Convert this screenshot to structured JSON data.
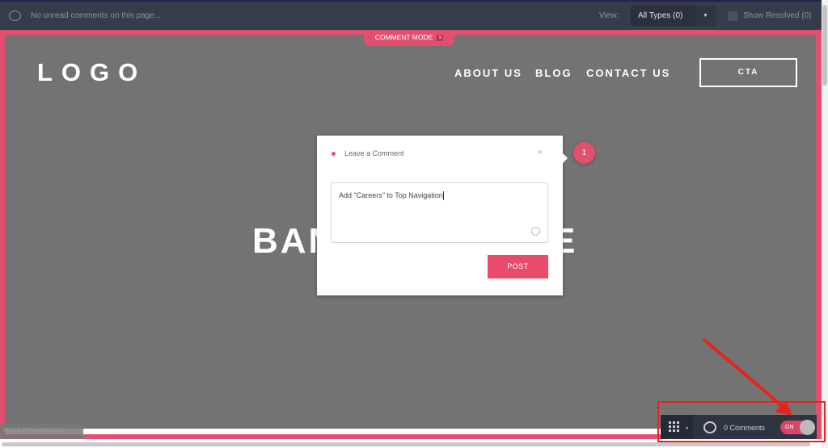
{
  "topbar": {
    "status": "No unread comments on this page...",
    "view_label": "View:",
    "view_select": "All Types (0)",
    "show_resolved": "Show Resolved (0)"
  },
  "comment_mode": {
    "label": "COMMENT MODE",
    "close": "x"
  },
  "site": {
    "logo": "LOGO",
    "nav": [
      "ABOUT US",
      "BLOG",
      "CONTACT US"
    ],
    "cta": "CTA",
    "banner_left": "BAN",
    "banner_right": "E"
  },
  "dialog": {
    "title": "Leave a Comment",
    "close": "×",
    "text": "Add \"Careers\" to Top Navigation",
    "post": "POST"
  },
  "pin": {
    "number": "1"
  },
  "made_with": "MADE WITH INVISION",
  "bottom_bar": {
    "comments": "0 Comments",
    "toggle": "ON"
  },
  "colors": {
    "accent": "#e2506f",
    "toolbar": "#363c4b",
    "annotation": "#e8231c"
  }
}
